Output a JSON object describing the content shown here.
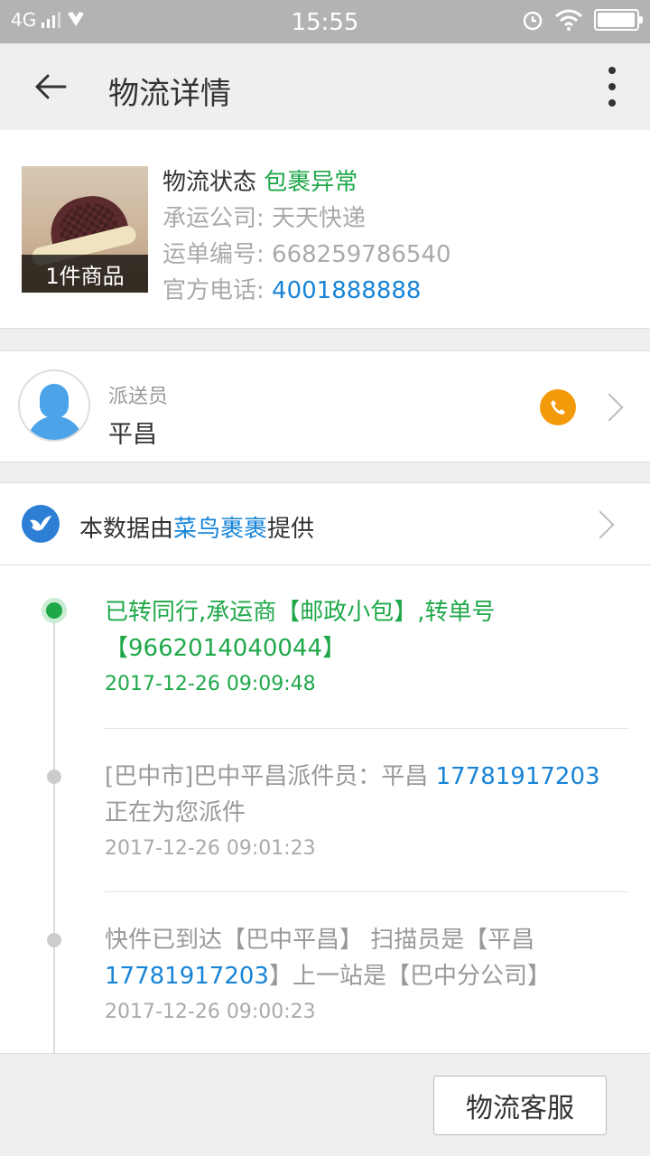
{
  "status_bar": {
    "network": "4G",
    "time": "15:55"
  },
  "header": {
    "title": "物流详情"
  },
  "package": {
    "item_count_label": "1件商品",
    "status_label": "物流状态",
    "status_value": "包裹异常",
    "carrier_label": "承运公司: ",
    "carrier_value": "天天快递",
    "tracking_label": "运单编号: ",
    "tracking_value": "668259786540",
    "phone_label": "官方电话: ",
    "phone_value": "4001888888"
  },
  "courier": {
    "label": "派送员",
    "name": "平昌"
  },
  "provider": {
    "prefix": "本数据由",
    "name": "菜鸟裹裹",
    "suffix": "提供"
  },
  "timeline": [
    {
      "line1": "已转同行,承运商【邮政小包】,转单号",
      "line2": "【9662014040044】",
      "time": "2017-12-26 09:09:48"
    },
    {
      "line1_prefix": "[巴中市]巴中平昌派件员：平昌 ",
      "line1_phone": "17781917203",
      "line2": "正在为您派件",
      "time": "2017-12-26 09:01:23"
    },
    {
      "line1": "快件已到达【巴中平昌】 扫描员是【平昌",
      "line2_phone": "17781917203",
      "line2_suffix": "】上一站是【巴中分公司】",
      "time": "2017-12-26 09:00:23"
    }
  ],
  "bottom": {
    "service_button": "物流客服"
  },
  "colors": {
    "accent_green": "#1fa84a",
    "link_blue": "#1784d8",
    "call_orange": "#f39a0b"
  }
}
